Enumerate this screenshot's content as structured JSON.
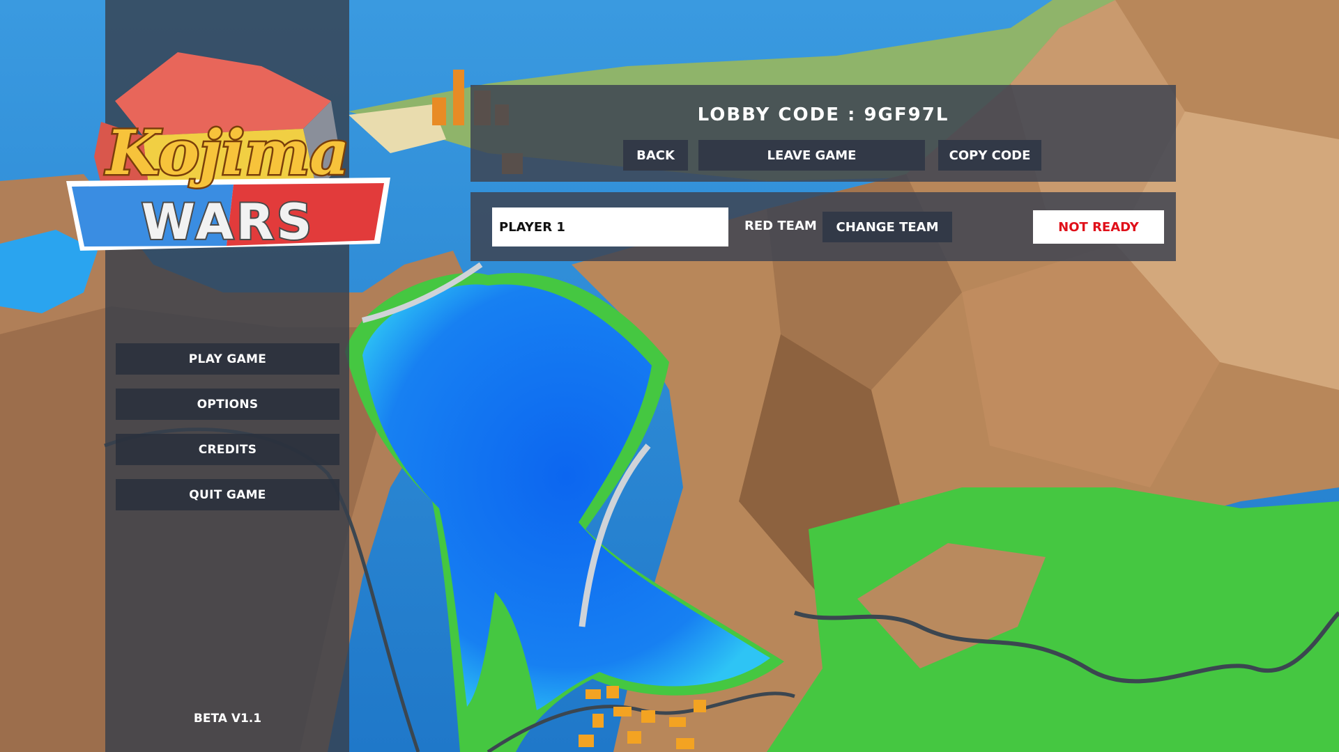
{
  "logo": {
    "line1": "Kojima",
    "line2": "WARS"
  },
  "menu": {
    "play": "PLAY GAME",
    "options": "OPTIONS",
    "credits": "CREDITS",
    "quit": "QUIT GAME"
  },
  "version": "BETA V1.1",
  "lobby": {
    "title": "LOBBY CODE : 9GF97L",
    "back_label": "BACK",
    "leave_label": "LEAVE GAME",
    "copy_label": "COPY CODE"
  },
  "player": {
    "name": "PLAYER 1",
    "team": "RED TEAM",
    "change_team_label": "CHANGE TEAM",
    "ready_status": "NOT READY"
  },
  "colors": {
    "sea": "#2f86d6",
    "lake": "#1470ee",
    "grass": "#3fbf3f",
    "rock": "#a57a55",
    "ready_text": "#e0101a"
  }
}
